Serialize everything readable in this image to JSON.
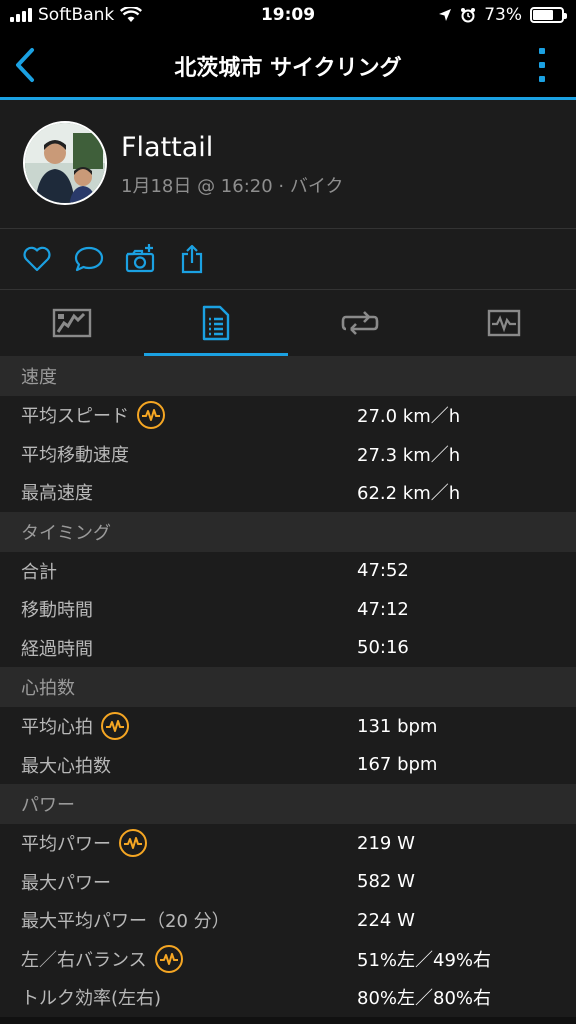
{
  "status_bar": {
    "carrier": "SoftBank",
    "time": "19:09",
    "battery": "73%"
  },
  "nav": {
    "title": "北茨城市 サイクリング"
  },
  "profile": {
    "name": "Flattail",
    "meta": "1月18日 @ 16:20 · バイク"
  },
  "sections": [
    {
      "title": "速度",
      "rows": [
        {
          "label": "平均スピード",
          "value": "27.0 km／h",
          "badge": true
        },
        {
          "label": "平均移動速度",
          "value": "27.3 km／h",
          "badge": false
        },
        {
          "label": "最高速度",
          "value": "62.2 km／h",
          "badge": false
        }
      ]
    },
    {
      "title": "タイミング",
      "rows": [
        {
          "label": "合計",
          "value": "47:52",
          "badge": false
        },
        {
          "label": "移動時間",
          "value": "47:12",
          "badge": false
        },
        {
          "label": "経過時間",
          "value": "50:16",
          "badge": false
        }
      ]
    },
    {
      "title": "心拍数",
      "rows": [
        {
          "label": "平均心拍",
          "value": "131 bpm",
          "badge": true
        },
        {
          "label": "最大心拍数",
          "value": "167 bpm",
          "badge": false
        }
      ]
    },
    {
      "title": "パワー",
      "rows": [
        {
          "label": "平均パワー",
          "value": "219 W",
          "badge": true
        },
        {
          "label": "最大パワー",
          "value": "582 W",
          "badge": false
        },
        {
          "label": "最大平均パワー（20 分）",
          "value": "224 W",
          "badge": false
        },
        {
          "label": "左／右バランス",
          "value": "51%左／49%右",
          "badge": true
        },
        {
          "label": "トルク効率(左右)",
          "value": "80%左／80%右",
          "badge": false
        }
      ]
    }
  ],
  "colors": {
    "accent": "#1ba1e2",
    "badge": "#f5a623",
    "background": "#1c1c1c",
    "section_header": "#2a2a2a"
  },
  "icons": {
    "back": "chevron-left-icon",
    "more": "more-vertical-icon",
    "like": "heart-icon",
    "comment": "comment-icon",
    "camera": "camera-add-icon",
    "share": "share-icon",
    "tab_map": "map-icon",
    "tab_stats": "document-list-icon",
    "tab_laps": "laps-icon",
    "tab_charts": "chart-icon"
  }
}
